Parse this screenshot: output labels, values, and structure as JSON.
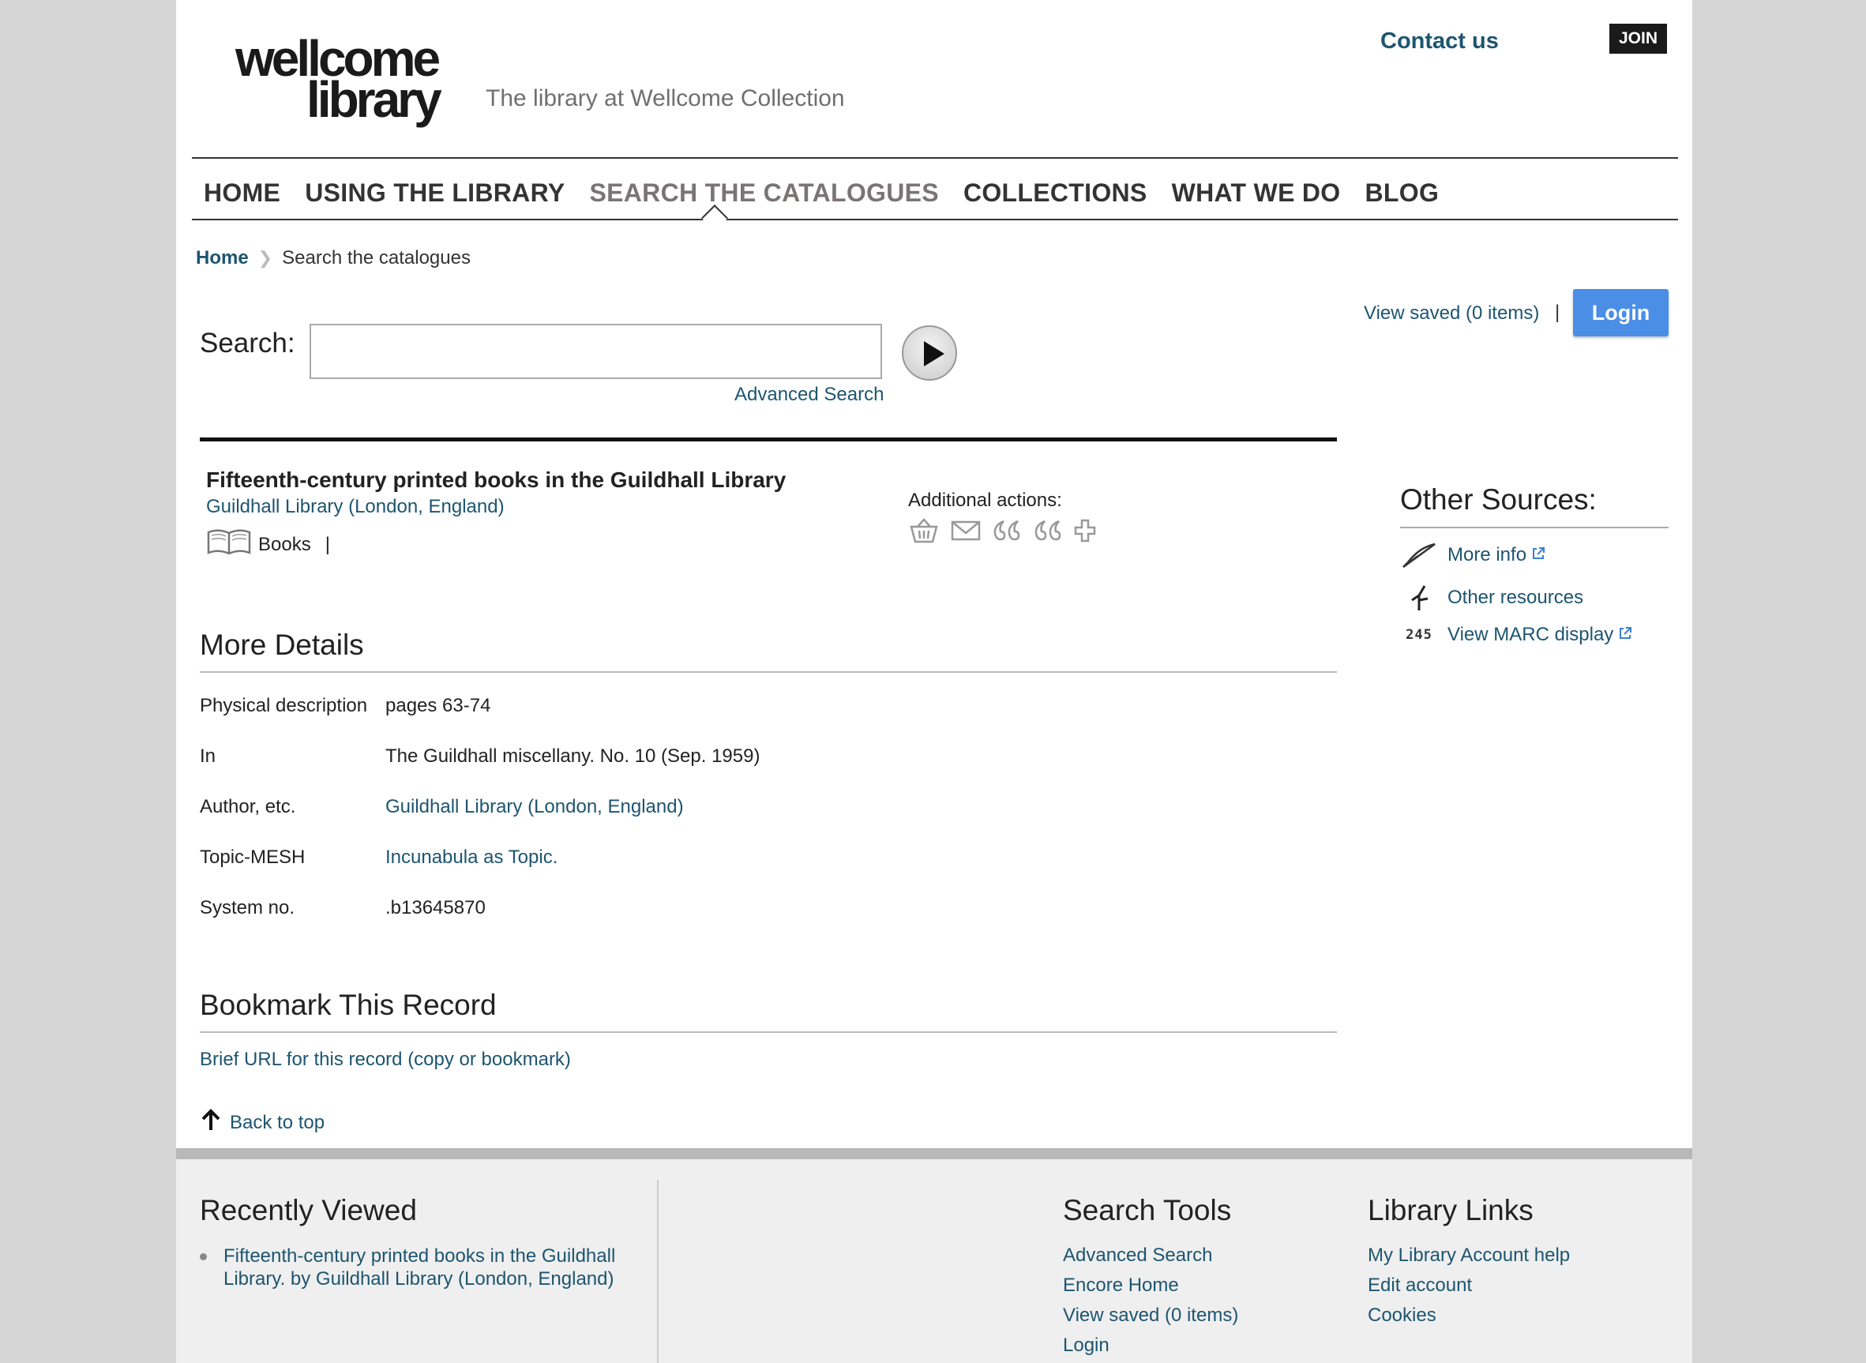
{
  "header": {
    "logo_line1": "wellcome",
    "logo_line2": "library",
    "tagline": "The library at Wellcome Collection",
    "contact": "Contact us",
    "join": "JOIN"
  },
  "nav": {
    "items": [
      "HOME",
      "USING THE LIBRARY",
      "SEARCH THE CATALOGUES",
      "COLLECTIONS",
      "WHAT WE DO",
      "BLOG"
    ],
    "active": "SEARCH THE CATALOGUES"
  },
  "breadcrumb": {
    "home": "Home",
    "current": "Search the catalogues"
  },
  "search": {
    "label": "Search:",
    "value": "",
    "advanced": "Advanced Search"
  },
  "account": {
    "view_saved": "View saved (0 items)",
    "separator": "|",
    "login": "Login"
  },
  "record": {
    "title": "Fifteenth-century printed books in the Guildhall Library",
    "author": "Guildhall Library (London, England)",
    "format": "Books",
    "format_sep": "|",
    "additional_actions": "Additional actions:"
  },
  "details": {
    "heading": "More Details",
    "rows": [
      {
        "label": "Physical description",
        "value": "pages 63-74"
      },
      {
        "label": "In",
        "value": "The Guildhall miscellany. No. 10 (Sep. 1959)"
      },
      {
        "label": "Author, etc.",
        "value": "Guildhall Library (London, England)"
      },
      {
        "label": "Topic-MESH",
        "value": "Incunabula as Topic."
      },
      {
        "label": "System no.",
        "value": ".b13645870"
      }
    ]
  },
  "bookmark": {
    "heading": "Bookmark This Record",
    "link": "Brief URL for this record (copy or bookmark)"
  },
  "back_to_top": "Back to top",
  "other_sources": {
    "heading": "Other Sources:",
    "items": [
      {
        "label": "More info",
        "icon": "quill-icon"
      },
      {
        "label": "Other resources",
        "icon": "branch-icon"
      },
      {
        "label": "View MARC display",
        "icon": "marc-245-icon",
        "icon_text": "245"
      }
    ]
  },
  "footer": {
    "recently_viewed": {
      "heading": "Recently Viewed",
      "items": [
        "Fifteenth-century printed books in the Guildhall Library. by Guildhall Library (London, England)"
      ]
    },
    "search_tools": {
      "heading": "Search Tools",
      "links": [
        "Advanced Search",
        "Encore Home",
        "View saved (0 items)",
        "Login"
      ]
    },
    "library_links": {
      "heading": "Library Links",
      "links": [
        "My Library Account help",
        "Edit account",
        "Cookies"
      ]
    }
  },
  "colors": {
    "link": "#1d5570",
    "login_button": "#4a8ee6",
    "nav_active": "#7a7474"
  }
}
